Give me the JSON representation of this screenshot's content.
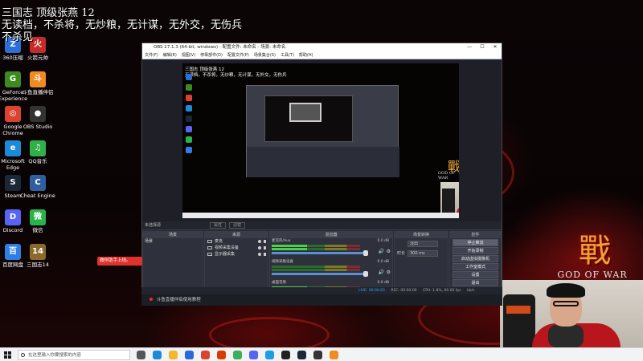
{
  "overlay": {
    "line1": "三国志 顶级张燕 12",
    "line2": "无读档，不杀将，无炒粮，无计谋，无外交，无伤兵",
    "line3": "不杀见"
  },
  "desktop_icons": [
    {
      "label": "360压缩",
      "color": "#2d6fd6",
      "glyph": "Z"
    },
    {
      "label": "火箭元帅",
      "color": "#c52b2b",
      "glyph": "火"
    },
    {
      "label": "GeForce Experience",
      "color": "#3d8b1f",
      "glyph": "G"
    },
    {
      "label": "斗鱼直播伴侣",
      "color": "#f08a22",
      "glyph": "斗"
    },
    {
      "label": "Google Chrome",
      "color": "#d9442e",
      "glyph": "◎"
    },
    {
      "label": "OBS Studio",
      "color": "#333333",
      "glyph": "●"
    },
    {
      "label": "Microsoft Edge",
      "color": "#1c8ad6",
      "glyph": "e"
    },
    {
      "label": "QQ音乐",
      "color": "#2fb14a",
      "glyph": "♫"
    },
    {
      "label": "Steam",
      "color": "#1b2838",
      "glyph": "S"
    },
    {
      "label": "Cheat Engine",
      "color": "#2f5f9f",
      "glyph": "C"
    },
    {
      "label": "Discord",
      "color": "#5865f2",
      "glyph": "D"
    },
    {
      "label": "微信",
      "color": "#29b34a",
      "glyph": "微"
    },
    {
      "label": "百度网盘",
      "color": "#2e7ee6",
      "glyph": "百"
    },
    {
      "label": "三国志14",
      "color": "#8a6a2a",
      "glyph": "14"
    }
  ],
  "float_button": "微伴助手上线。",
  "art": {
    "zhan": "戰",
    "godofwar": "GOD OF WAR"
  },
  "obs": {
    "title": "OBS 27.1.3 (64-bit, windows) - 配置文件: 未命名 - 场景: 未命名",
    "window_controls": [
      "—",
      "☐",
      "✕"
    ],
    "menu": [
      "文件(F)",
      "编辑(E)",
      "视图(V)",
      "停靠部件(D)",
      "配置文件(P)",
      "场景集合(S)",
      "工具(T)",
      "帮助(H)"
    ],
    "preview_text": [
      "三国志 顶级张燕 12",
      "无读档，不杀将，无炒粮，无计谋，无外交，无伤兵"
    ],
    "preview_zhan": "戰",
    "preview_gow": "GOD OF WAR",
    "toolbar": {
      "label": "未选择源",
      "properties": "属性",
      "filters": "滤镜"
    },
    "docks": {
      "scenes": {
        "title": "场景",
        "items": [
          "场景"
        ],
        "footer": "+ − ∧ ∨"
      },
      "sources": {
        "title": "来源",
        "items": [
          "麦克",
          "视频采集设备",
          "显示器采集"
        ],
        "footer": "+ − ⚙ ∧ ∨"
      },
      "mixer": {
        "title": "混音器",
        "channels": [
          {
            "name": "麦克风/Aux",
            "db": "0.0 dB"
          },
          {
            "name": "视频采集设备",
            "db": "0.0 dB"
          },
          {
            "name": "桌面音频",
            "db": "0.0 dB"
          }
        ]
      },
      "transitions": {
        "title": "场景转换",
        "type_label": "淡出",
        "duration_label": "时长",
        "duration_value": "300 ms"
      },
      "controls": {
        "title": "控件",
        "buttons": [
          "停止推流",
          "开始录制",
          "启动虚拟摄像机",
          "工作室模式",
          "设置",
          "退出"
        ]
      }
    },
    "status": {
      "live": "LIVE: 00:00:00",
      "rec": "REC: 00:00:00",
      "cpu": "CPU: 1.8%, 60.00 fps",
      "kbps": "kb/s"
    },
    "notification": "斗鱼直播伴侣使用教程"
  },
  "taskbar": {
    "search_placeholder": "在这里输入你要搜索的内容",
    "apps": [
      {
        "name": "task-view",
        "color": "#555555"
      },
      {
        "name": "edge",
        "color": "#1c8ad6"
      },
      {
        "name": "explorer",
        "color": "#f2b632"
      },
      {
        "name": "store",
        "color": "#2a6ad6"
      },
      {
        "name": "chrome",
        "color": "#d9442e"
      },
      {
        "name": "office",
        "color": "#d83b01"
      },
      {
        "name": "chrome2",
        "color": "#3cae5c"
      },
      {
        "name": "discord",
        "color": "#5865f2"
      },
      {
        "name": "qq",
        "color": "#1aa0e6"
      },
      {
        "name": "obs",
        "color": "#222222"
      },
      {
        "name": "steam",
        "color": "#1b2838"
      },
      {
        "name": "obs2",
        "color": "#333333"
      },
      {
        "name": "douyu",
        "color": "#f08a22"
      }
    ]
  }
}
